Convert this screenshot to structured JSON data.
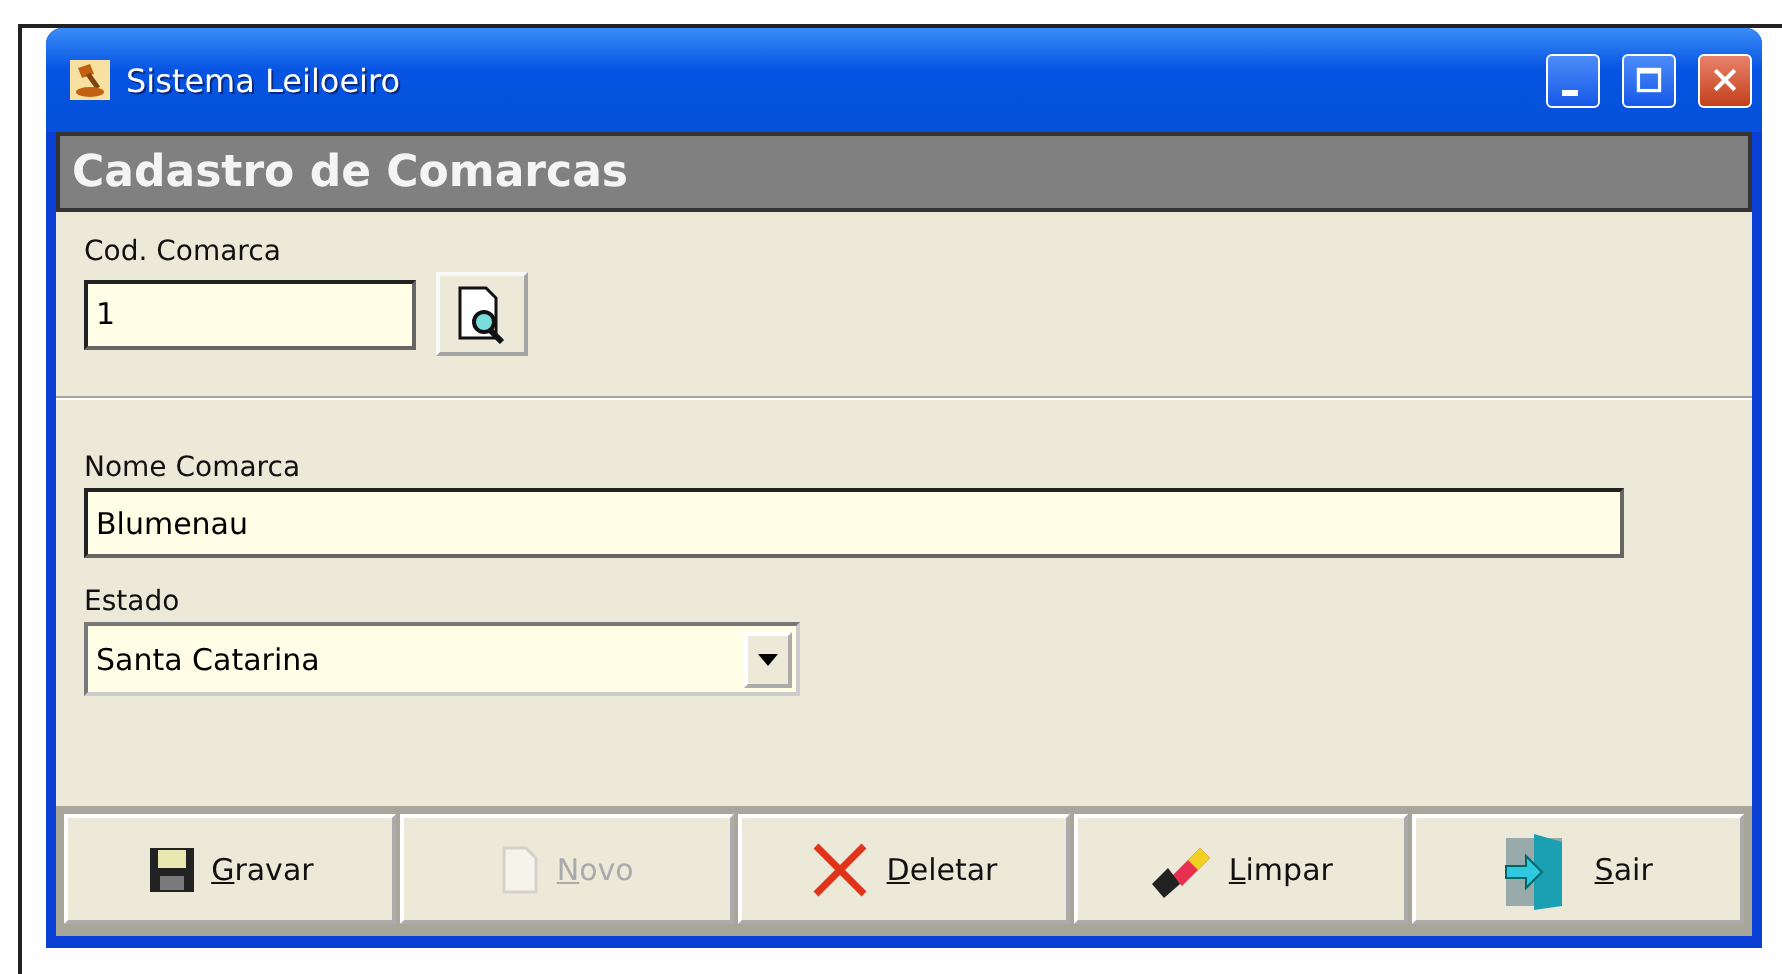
{
  "window": {
    "title": "Sistema Leiloeiro"
  },
  "header": {
    "title": "Cadastro de Comarcas"
  },
  "code_field": {
    "label": "Cod. Comarca",
    "value": "1"
  },
  "name_field": {
    "label": "Nome Comarca",
    "value": "Blumenau"
  },
  "state_field": {
    "label": "Estado",
    "value": "Santa Catarina"
  },
  "buttons": [
    {
      "kind": "save",
      "label": "Gravar",
      "underline_first": true,
      "disabled": false
    },
    {
      "kind": "new",
      "label": "Novo",
      "underline_first": true,
      "disabled": true
    },
    {
      "kind": "delete",
      "label": "Deletar",
      "underline_first": true,
      "disabled": false
    },
    {
      "kind": "clear",
      "label": "Limpar",
      "underline_first": true,
      "disabled": false
    },
    {
      "kind": "exit",
      "label": "Sair",
      "underline_first": true,
      "disabled": false
    }
  ]
}
